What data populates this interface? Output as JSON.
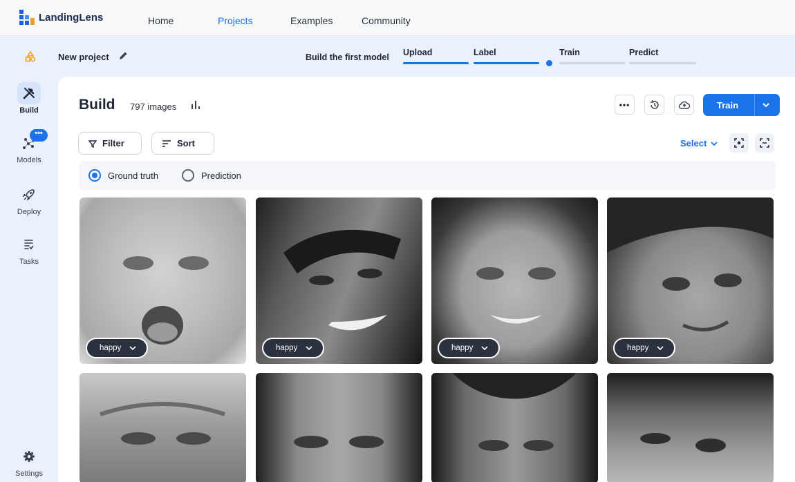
{
  "app": {
    "brand": "LandingLens"
  },
  "nav": {
    "home": "Home",
    "projects": "Projects",
    "examples": "Examples",
    "community": "Community"
  },
  "project": {
    "name": "New project",
    "build_label": "Build the first model",
    "steps": {
      "upload": "Upload",
      "label": "Label",
      "train": "Train",
      "predict": "Predict"
    }
  },
  "sidebar": {
    "build": "Build",
    "models": "Models",
    "models_badge": "•••",
    "deploy": "Deploy",
    "tasks": "Tasks",
    "settings": "Settings"
  },
  "main": {
    "title": "Build",
    "image_count": "797 images",
    "more_label": "•••",
    "train_label": "Train",
    "filter_label": "Filter",
    "sort_label": "Sort",
    "select_label": "Select",
    "ground_truth": "Ground truth",
    "prediction": "Prediction",
    "view_mode_selected": "Ground truth"
  },
  "images": [
    {
      "label": "happy"
    },
    {
      "label": "happy"
    },
    {
      "label": "happy"
    },
    {
      "label": "happy"
    }
  ],
  "colors": {
    "accent": "#1a73e8",
    "tag_bg": "#2c3140",
    "page_bg": "#eaf1fc"
  }
}
